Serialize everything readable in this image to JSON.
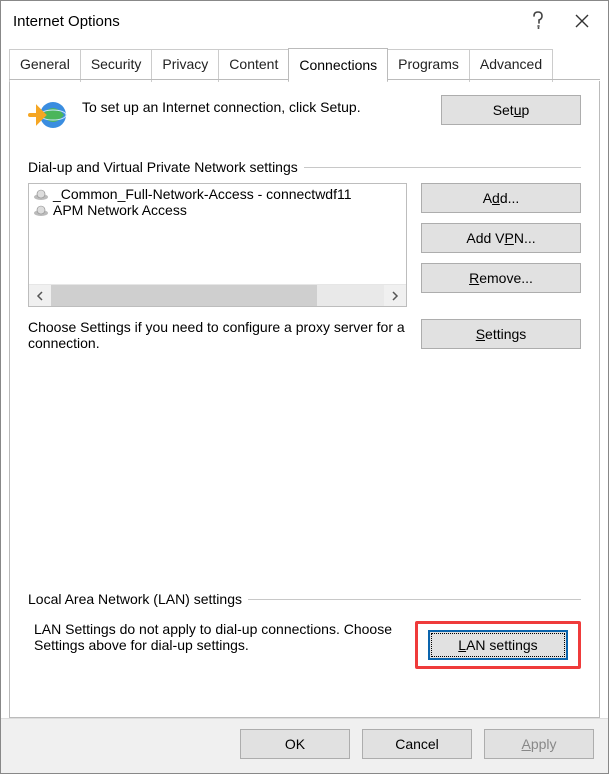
{
  "window": {
    "title": "Internet Options"
  },
  "tabs": [
    "General",
    "Security",
    "Privacy",
    "Content",
    "Connections",
    "Programs",
    "Advanced"
  ],
  "active_tab_index": 4,
  "setup": {
    "text": "To set up an Internet connection, click Setup.",
    "button": "Setup",
    "button_accel": "u"
  },
  "dialup": {
    "header": "Dial-up and Virtual Private Network settings",
    "items": [
      "_Common_Full-Network-Access - connectwdf11",
      "APM Network Access"
    ],
    "add": "Add...",
    "add_accel": "d",
    "add_vpn": "Add VPN...",
    "add_vpn_accel": "P",
    "remove": "Remove...",
    "remove_accel": "R",
    "settings": "Settings",
    "settings_accel": "S",
    "help": "Choose Settings if you need to configure a proxy server for a connection."
  },
  "lan": {
    "header": "Local Area Network (LAN) settings",
    "help": "LAN Settings do not apply to dial-up connections. Choose Settings above for dial-up settings.",
    "button": "LAN settings",
    "button_accel": "L"
  },
  "buttons": {
    "ok": "OK",
    "cancel": "Cancel",
    "apply": "Apply",
    "apply_accel": "A"
  }
}
